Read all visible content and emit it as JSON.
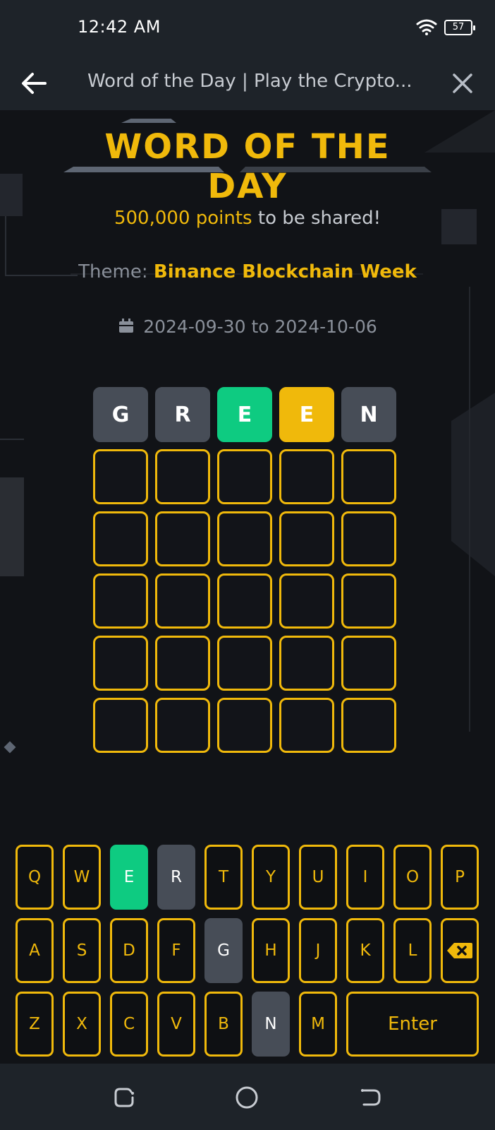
{
  "status": {
    "time": "12:42 AM",
    "battery": "57"
  },
  "titlebar": {
    "title": "Word of the Day | Play the Crypto..."
  },
  "game": {
    "heading": "WORD OF THE DAY",
    "points_value": "500,000 points",
    "points_rest": " to be shared!",
    "theme_label": "Theme: ",
    "theme_value": "Binance Blockchain Week",
    "dates": "2024-09-30 to 2024-10-06",
    "guess": [
      {
        "letter": "G",
        "state": "absent"
      },
      {
        "letter": "R",
        "state": "absent"
      },
      {
        "letter": "E",
        "state": "correct"
      },
      {
        "letter": "E",
        "state": "present"
      },
      {
        "letter": "N",
        "state": "absent"
      }
    ],
    "rows": 6,
    "cols": 5
  },
  "keyboard": {
    "row1": [
      "Q",
      "W",
      "E",
      "R",
      "T",
      "Y",
      "U",
      "I",
      "O",
      "P"
    ],
    "row2": [
      "A",
      "S",
      "D",
      "F",
      "G",
      "H",
      "J",
      "K",
      "L"
    ],
    "row3": [
      "Z",
      "X",
      "C",
      "V",
      "B",
      "N",
      "M"
    ],
    "enter_label": "Enter",
    "correct_keys": [
      "E"
    ],
    "absent_keys": [
      "R",
      "G",
      "N"
    ]
  },
  "colors": {
    "accent": "#f0b90b",
    "correct": "#0ecb81",
    "absent": "#474d57"
  },
  "icons": [
    "wifi-icon",
    "battery-icon",
    "back-arrow-icon",
    "close-icon",
    "calendar-icon",
    "backspace-icon",
    "recents-icon",
    "home-icon",
    "back-nav-icon"
  ]
}
